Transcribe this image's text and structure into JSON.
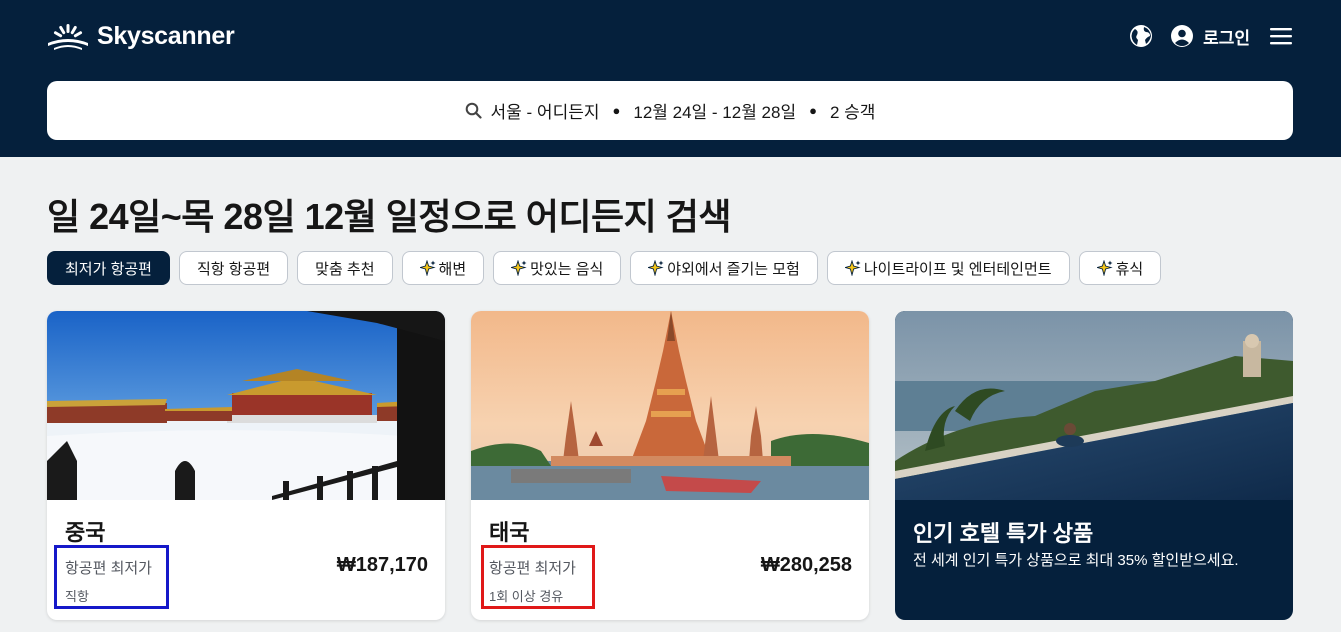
{
  "header": {
    "brand": "Skyscanner",
    "login_label": "로그인"
  },
  "search": {
    "route": "서울 - 어디든지",
    "dates": "12월 24일 - 12월 28일",
    "travelers": "2 승객"
  },
  "page_title": "일 24일~목 28일 12월 일정으로 어디든지 검색",
  "filters": [
    {
      "label": "최저가 항공편",
      "active": true
    },
    {
      "label": "직항 항공편"
    },
    {
      "label": "맞춤 추천"
    },
    {
      "label": "해변",
      "icon": "sparkle-icon"
    },
    {
      "label": "맛있는 음식",
      "icon": "sparkle-icon"
    },
    {
      "label": "야외에서 즐기는 모험",
      "icon": "sparkle-icon"
    },
    {
      "label": "나이트라이프 및 엔터테인먼트",
      "icon": "sparkle-icon"
    },
    {
      "label": "휴식",
      "icon": "sparkle-icon"
    }
  ],
  "cards": [
    {
      "name": "중국",
      "label": "항공편 최저가",
      "stops": "직항",
      "price": "₩187,170",
      "highlight_color": "#1518c9"
    },
    {
      "name": "태국",
      "label": "항공편 최저가",
      "stops": "1회 이상 경유",
      "price": "₩280,258",
      "highlight_color": "#e01818"
    }
  ],
  "promo": {
    "title": "인기 호텔 특가 상품",
    "description": "전 세계 인기 특가 상품으로 최대 35% 할인받으세요."
  },
  "colors": {
    "navy": "#05203c",
    "page_bg": "#eff1f2"
  }
}
